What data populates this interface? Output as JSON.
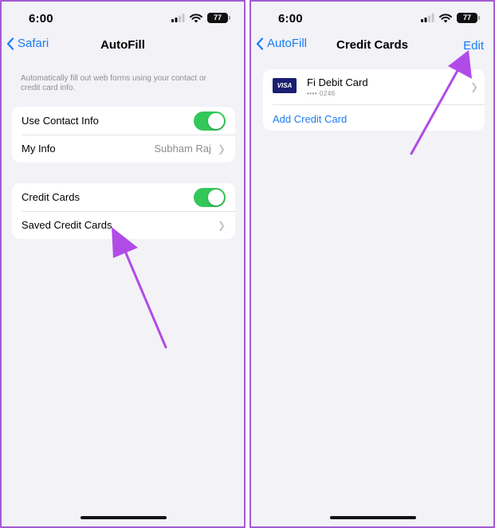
{
  "colors": {
    "accent": "#1a7cf5",
    "toggle_on": "#34c759",
    "annotation": "#b14be8",
    "frame": "#a35bd6"
  },
  "left_screen": {
    "status": {
      "time": "6:00",
      "battery": "77"
    },
    "nav": {
      "back_label": "Safari",
      "title": "AutoFill"
    },
    "description": "Automatically fill out web forms using your contact or credit card info.",
    "contact_group": {
      "use_contact_info": {
        "label": "Use Contact Info",
        "toggle_on": true
      },
      "my_info": {
        "label": "My Info",
        "value": "Subham Raj"
      }
    },
    "card_group": {
      "credit_cards": {
        "label": "Credit Cards",
        "toggle_on": true
      },
      "saved_credit_cards": {
        "label": "Saved Credit Cards"
      }
    }
  },
  "right_screen": {
    "status": {
      "time": "6:00",
      "battery": "77"
    },
    "nav": {
      "back_label": "AutoFill",
      "title": "Credit Cards",
      "action_label": "Edit"
    },
    "cards": [
      {
        "brand": "VISA",
        "name": "Fi Debit Card",
        "number": "•••• 0246"
      }
    ],
    "add_card_label": "Add Credit Card"
  }
}
